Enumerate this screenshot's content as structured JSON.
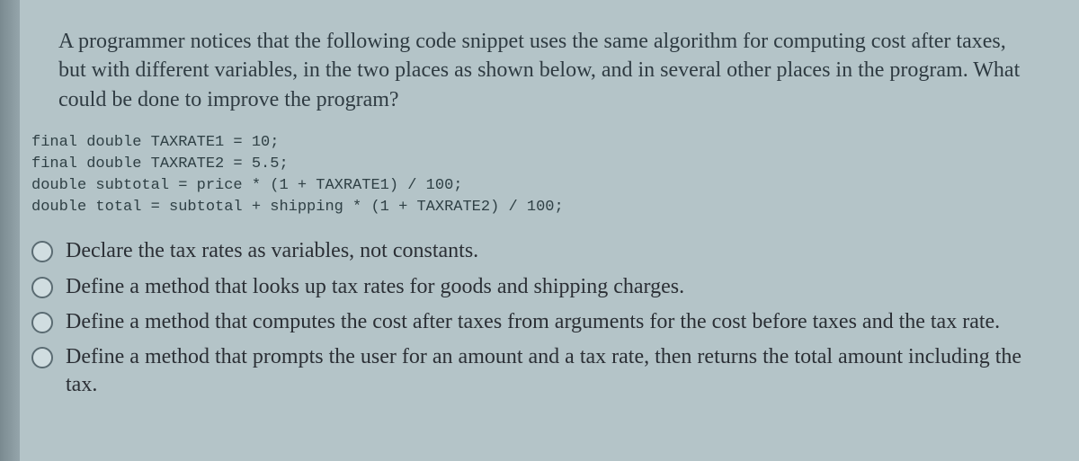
{
  "question": "A programmer notices that the following code snippet uses the same algorithm for computing cost after taxes, but with different variables, in the two places as shown below, and in several other places in the program. What could be done to improve the program?",
  "code": "final double TAXRATE1 = 10;\nfinal double TAXRATE2 = 5.5;\ndouble subtotal = price * (1 + TAXRATE1) / 100;\ndouble total = subtotal + shipping * (1 + TAXRATE2) / 100;",
  "options": [
    "Declare the tax rates as variables, not constants.",
    "Define a method that looks up tax rates for goods and shipping charges.",
    "Define a method that computes the cost after taxes from arguments for the cost before taxes and the tax rate.",
    "Define a method that prompts the user for an amount and a tax rate, then returns the total amount including the tax."
  ]
}
